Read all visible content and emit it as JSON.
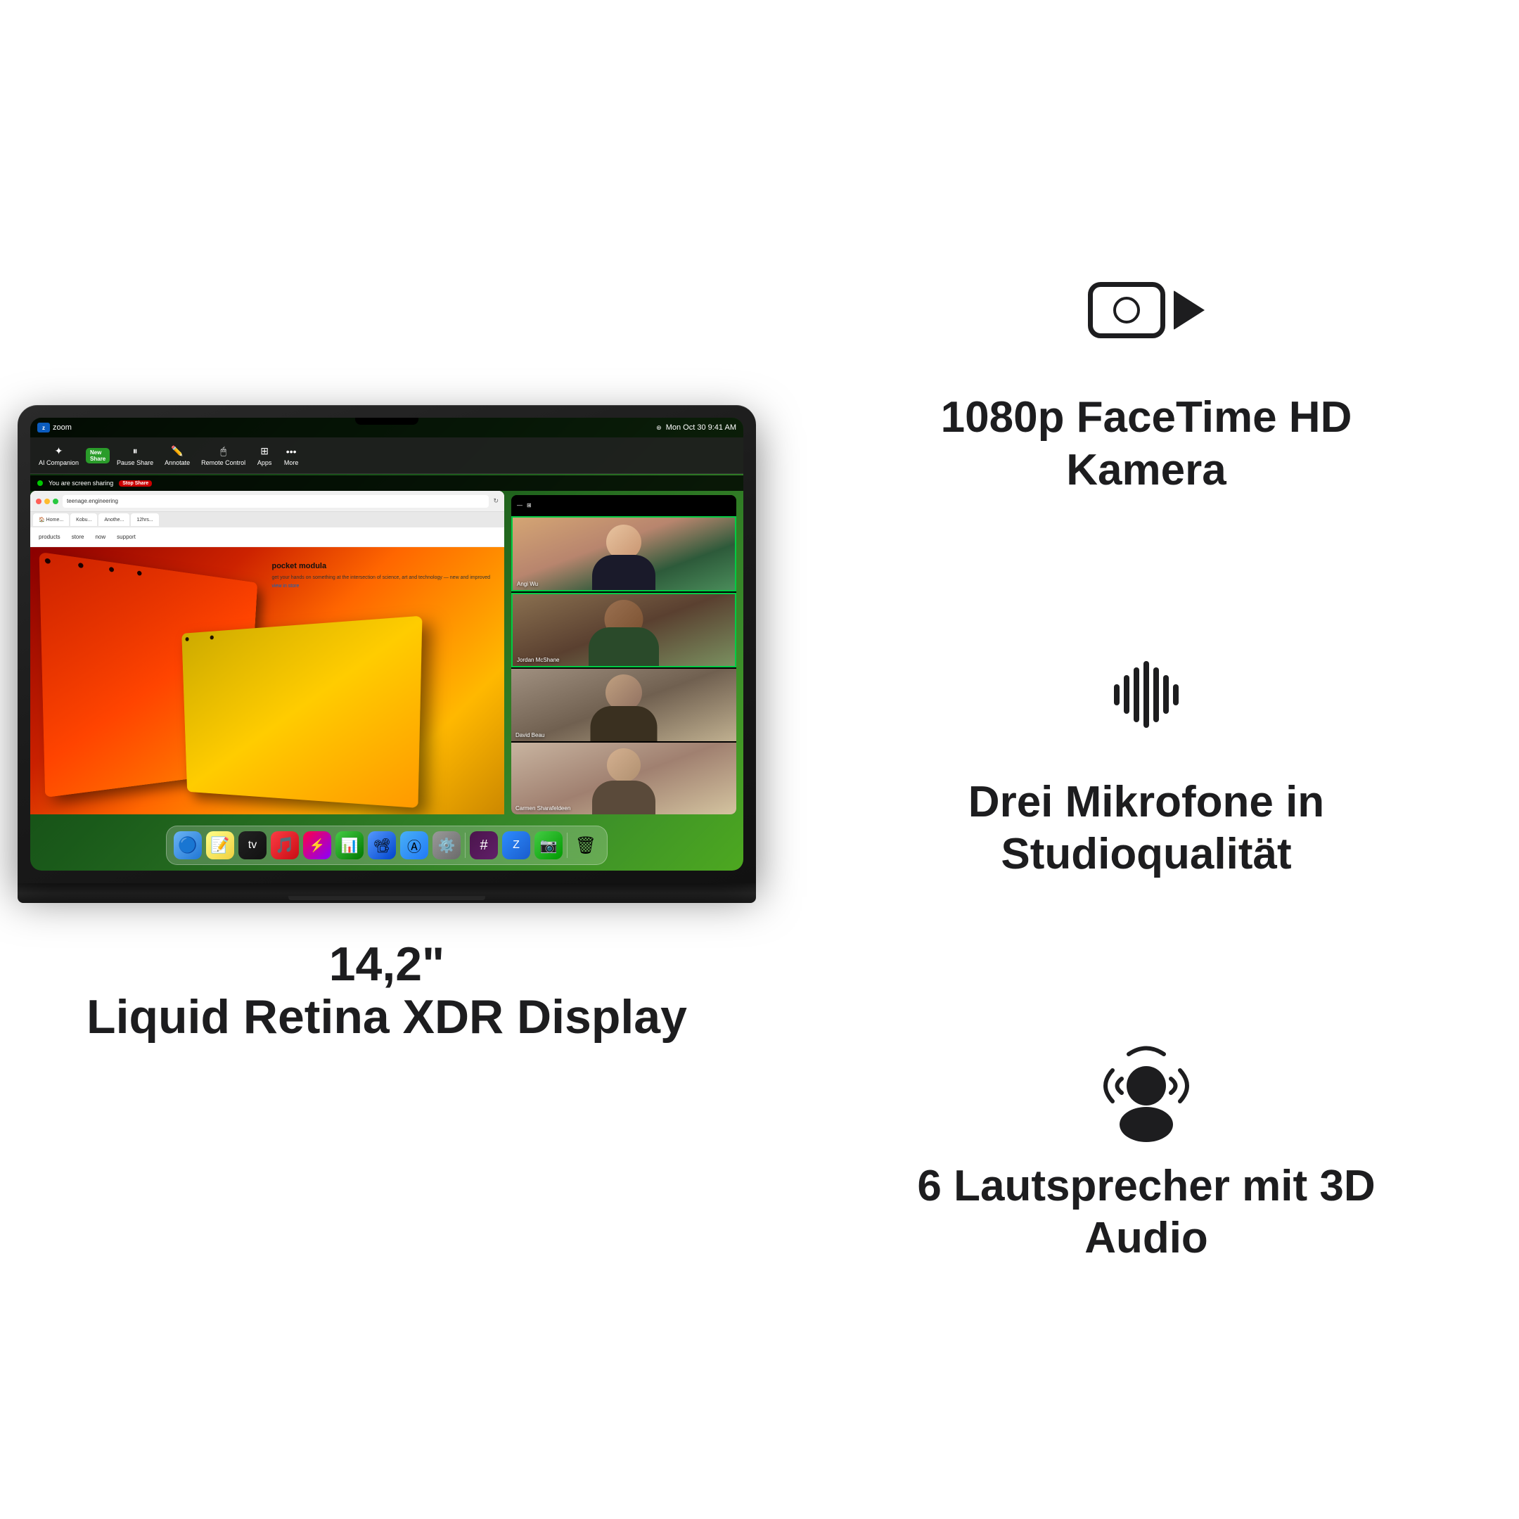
{
  "left": {
    "macbook": {
      "screen": {
        "menubar": {
          "app": "zoom",
          "time": "Mon Oct 30  9:41 AM"
        },
        "zoom_toolbar": {
          "ai_companion": "AI Companion",
          "new_share": "New Share",
          "pause_share": "Pause Share",
          "annotate": "Annotate",
          "remote_control": "Remote Control",
          "apps": "Apps",
          "more": "More"
        },
        "sharing_banner": {
          "text": "You are screen sharing",
          "stop_button": "Stop Share"
        },
        "browser": {
          "url": "teenage.engineering",
          "tabs": [
            "Home...",
            "Kobu...",
            "Anothe...",
            "12hrs..."
          ],
          "nav_items": [
            "products",
            "store",
            "now",
            "support"
          ]
        },
        "hero_content": {
          "title": "pocket\nmodula",
          "description": "get your hands on something at the intersection of\nscience, art and technology — new and improved",
          "link": "view in store"
        },
        "participants": [
          {
            "name": "Angi Wu",
            "active": true
          },
          {
            "name": "Jordan McShane",
            "active": true
          },
          {
            "name": "David Beau",
            "active": false
          },
          {
            "name": "Carmen Sharafeldeen",
            "active": false
          }
        ]
      }
    },
    "label": {
      "line1": "14,2\"",
      "line2": "Liquid Retina XDR Display"
    }
  },
  "right": {
    "features": [
      {
        "id": "camera",
        "icon_type": "camera",
        "title": "1080p FaceTime HD\nKamera"
      },
      {
        "id": "microphones",
        "icon_type": "waveform",
        "title": "Drei Mikrofone\nin Studioqualität"
      },
      {
        "id": "speakers",
        "icon_type": "person-audio",
        "title": "6 Lautsprecher\nmit 3D Audio"
      }
    ]
  }
}
